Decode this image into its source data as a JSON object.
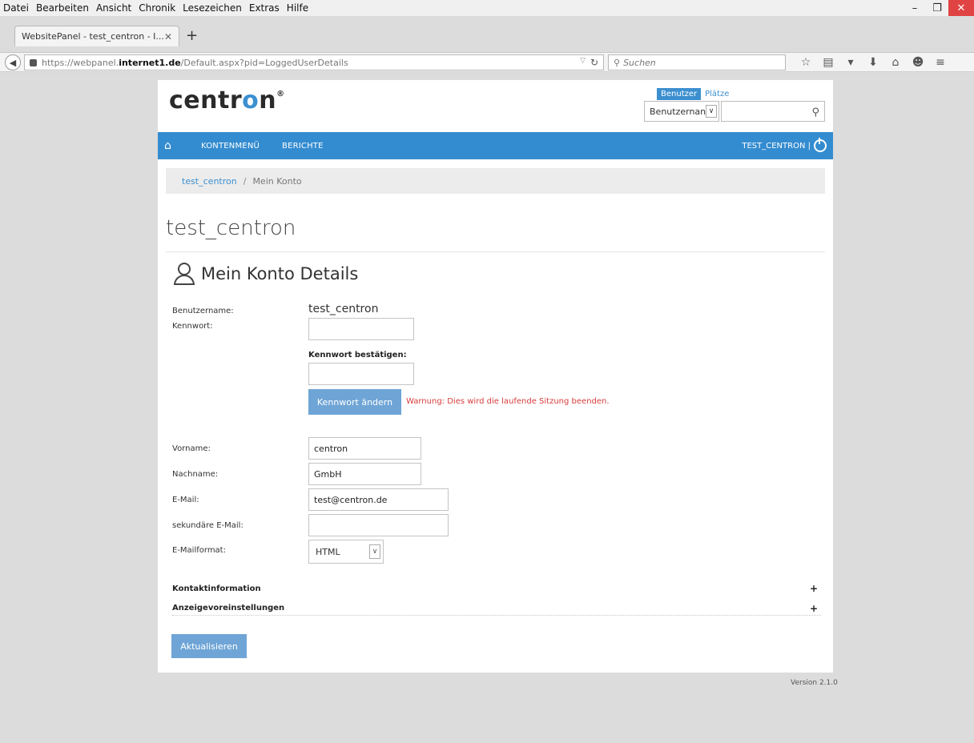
{
  "browser": {
    "menu": [
      "Datei",
      "Bearbeiten",
      "Ansicht",
      "Chronik",
      "Lesezeichen",
      "Extras",
      "Hilfe"
    ],
    "tab_title": "WebsitePanel - test_centron - I...",
    "url_prefix": "https://webpanel.",
    "url_host": "internet1.de",
    "url_path": "/Default.aspx?pid=LoggedUserDetails",
    "search_placeholder": "Suchen"
  },
  "header": {
    "logo_prefix": "centr",
    "logo_accent": "o",
    "logo_suffix": "n",
    "logo_mark": "®",
    "search_tab_active": "Benutzer",
    "search_tab_inactive": "Plätze",
    "search_select_value": "Benutzernan"
  },
  "nav": {
    "items": [
      "KONTENMENÜ",
      "BERICHTE"
    ],
    "user_label": "TEST_CENTRON |"
  },
  "breadcrumb": {
    "link": "test_centron",
    "separator": "/",
    "current": "Mein Konto"
  },
  "page": {
    "title": "test_centron",
    "section_title": "Mein Konto Details"
  },
  "form": {
    "username_label": "Benutzername:",
    "username_value": "test_centron",
    "password_label": "Kennwort:",
    "confirm_label": "Kennwort bestätigen:",
    "change_button": "Kennwort ändern",
    "warning": "Warnung: Dies wird die laufende Sitzung beenden.",
    "firstname_label": "Vorname:",
    "firstname_value": "centron",
    "lastname_label": "Nachname:",
    "lastname_value": "GmbH",
    "email_label": "E-Mail:",
    "email_value": "test@centron.de",
    "secondary_email_label": "sekundäre E-Mail:",
    "secondary_email_value": "",
    "format_label": "E-Mailformat:",
    "format_value": "HTML",
    "contact_section": "Kontaktinformation",
    "display_section": "Anzeigevoreinstellungen",
    "update_button": "Aktualisieren"
  },
  "footer": {
    "version": "Version 2.1.0"
  },
  "colors": {
    "accent": "#348cd0",
    "button": "#6fa5d6",
    "warning": "#d93c3c"
  }
}
